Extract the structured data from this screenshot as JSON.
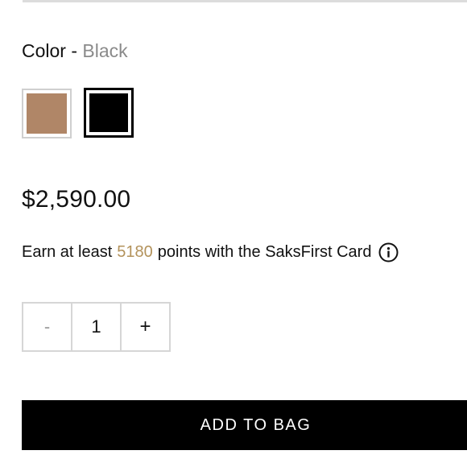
{
  "color": {
    "label": "Color",
    "separator": "-",
    "selected": "Black",
    "swatches": [
      {
        "name": "tan",
        "hex": "#b08667"
      },
      {
        "name": "black",
        "hex": "#000000",
        "selected": true
      }
    ]
  },
  "price": "$2,590.00",
  "rewards": {
    "prefix": "Earn at least",
    "points": "5180",
    "suffix": "points with the SaksFirst Card",
    "icon": "info-icon",
    "points_color": "#b3925b"
  },
  "quantity": {
    "decrement": "-",
    "value": "1",
    "increment": "+"
  },
  "cta": {
    "label": "ADD TO BAG"
  }
}
